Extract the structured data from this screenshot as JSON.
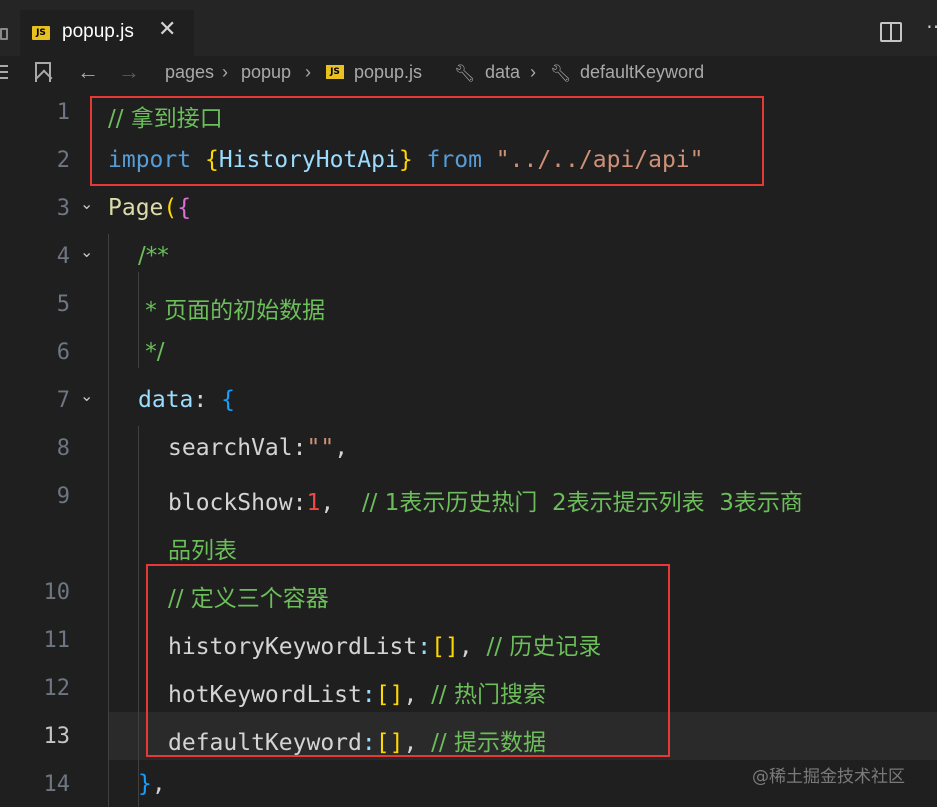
{
  "tab": {
    "title": "popup.js",
    "icon": "JS",
    "close": "✕"
  },
  "topbar": {
    "more": "⋯"
  },
  "breadcrumb": {
    "items": [
      "pages",
      "popup",
      "popup.js",
      "data",
      "defaultKeyword"
    ],
    "separator": "›",
    "back": "←",
    "forward": "→"
  },
  "code": {
    "line1_comment": "// 拿到接口",
    "line2": {
      "import": "import",
      "open": "{",
      "name": "HistoryHotApi",
      "close": "}",
      "from": "from",
      "path": "\"../../api/api\""
    },
    "line3": {
      "page": "Page",
      "paren": "(",
      "brace": "{"
    },
    "line4": "/**",
    "line5": " * 页面的初始数据",
    "line6": " */",
    "line7": {
      "key": "data",
      "colon": ":",
      "brace": "{"
    },
    "line8": {
      "key": "searchVal",
      "colon": ":",
      "value": "\"\"",
      "comma": ","
    },
    "line9": {
      "key": "blockShow",
      "colon": ":",
      "value": "1",
      "comma": ",",
      "comment": "// 1表示历史热门  2表示提示列表  3表示商",
      "comment_wrap": "品列表"
    },
    "line10": "// 定义三个容器",
    "line11": {
      "key": "historyKeywordList",
      "colon": ":",
      "value": "[]",
      "comma": ",",
      "comment": "// 历史记录"
    },
    "line12": {
      "key": "hotKeywordList",
      "colon": ":",
      "value": "[]",
      "comma": ",",
      "comment": "// 热门搜索"
    },
    "line13": {
      "key": "defaultKeyword",
      "colon": ":",
      "value": "[]",
      "comma": ",",
      "comment": "// 提示数据"
    },
    "line14": {
      "brace": "}",
      "comma": ","
    }
  },
  "line_numbers": [
    "1",
    "2",
    "3",
    "4",
    "5",
    "6",
    "7",
    "8",
    "9",
    "10",
    "11",
    "12",
    "13",
    "14"
  ],
  "watermark": "@稀土掘金技术社区",
  "colors": {
    "highlight_box": "#e53935",
    "comment": "#6bbe5a",
    "keyword": "#569cd6"
  }
}
